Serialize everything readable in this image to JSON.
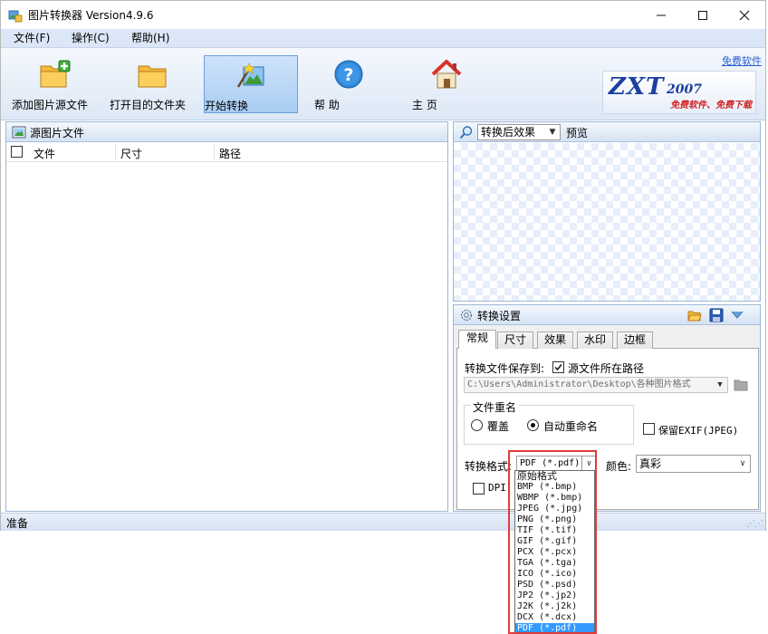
{
  "window": {
    "title": "图片转换器 Version4.9.6"
  },
  "menu": [
    "文件(F)",
    "操作(C)",
    "帮助(H)"
  ],
  "toolbar": {
    "add_source": "添加图片源文件",
    "open_target": "打开目的文件夹",
    "start": "开始转换",
    "help": "帮 助",
    "home": "主 页",
    "free_link": "免费软件"
  },
  "logo": {
    "main": "ZXT",
    "year": "2007",
    "tagline": "免费软件、免费下载"
  },
  "source_panel": {
    "title": "源图片文件",
    "columns": [
      "文件",
      "尺寸",
      "路径"
    ]
  },
  "preview_panel": {
    "mode": "转换后效果",
    "preview_label": "预览"
  },
  "settings_panel": {
    "title": "转换设置",
    "tabs": [
      "常规",
      "尺寸",
      "效果",
      "水印",
      "边框"
    ],
    "active_tab": "常规",
    "save_to_label": "转换文件保存到:",
    "source_path_checkbox": "源文件所在路径",
    "source_path_checked": true,
    "path_value": "C:\\Users\\Administrator\\Desktop\\各种图片格式",
    "rename_group": "文件重名",
    "rename_overwrite": "覆盖",
    "rename_auto": "自动重命名",
    "rename_selected": "自动重命名",
    "keep_exif": "保留EXIF(JPEG)",
    "keep_exif_checked": false,
    "format_label": "转换格式:",
    "format_value": "PDF (*.pdf)",
    "color_label": "颜色:",
    "color_value": "真彩",
    "dpi_label": "DPI:",
    "dpi_checked": false
  },
  "format_dropdown": {
    "options": [
      "原始格式",
      "BMP (*.bmp)",
      "WBMP (*.bmp)",
      "JPEG (*.jpg)",
      "PNG (*.png)",
      "TIF (*.tif)",
      "GIF (*.gif)",
      "PCX (*.pcx)",
      "TGA (*.tga)",
      "ICO (*.ico)",
      "PSD (*.psd)",
      "JP2 (*.jp2)",
      "J2K (*.j2k)",
      "DCX (*.dcx)",
      "PDF (*.pdf)"
    ],
    "selected": "PDF (*.pdf)"
  },
  "status": {
    "text": "准备"
  },
  "colors": {
    "menu_bg": "#dbe6f6",
    "highlight": "#3399ff",
    "callout": "#e23b3b",
    "logo_blue": "#1b3fa0"
  }
}
